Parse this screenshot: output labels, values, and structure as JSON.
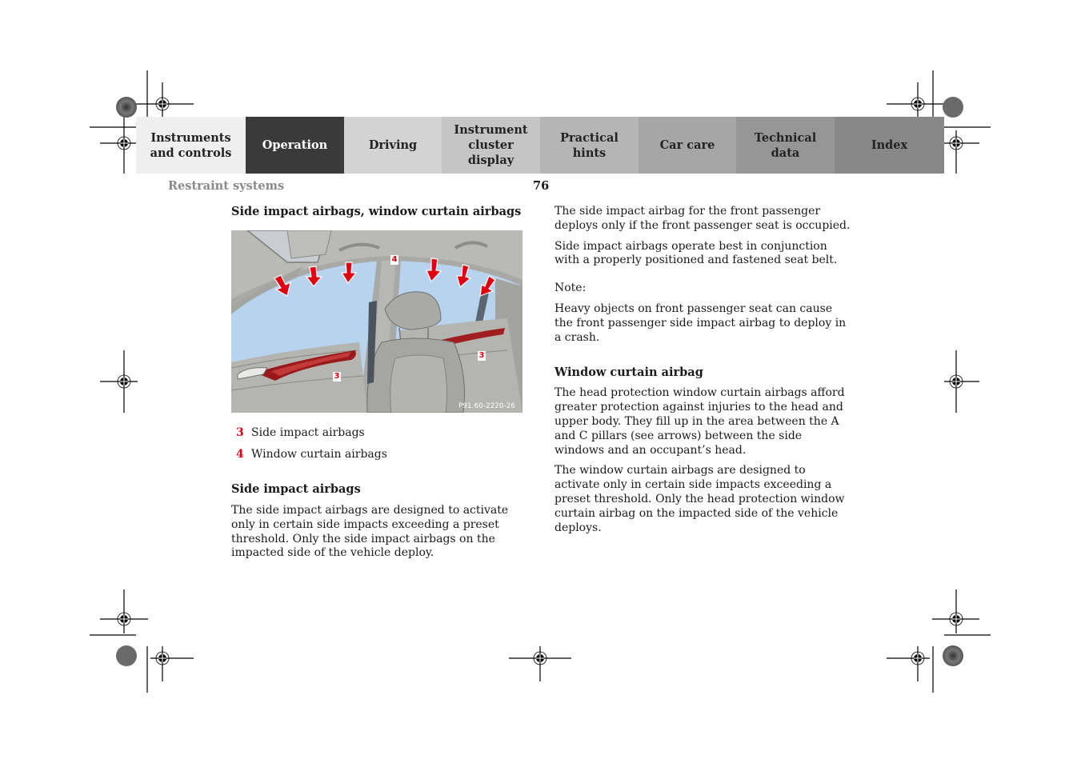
{
  "nav": {
    "tabs": [
      {
        "label": "Instruments\nand controls",
        "color": "#efefef",
        "active": false
      },
      {
        "label": "Operation",
        "color": "#3a3a3a",
        "active": true
      },
      {
        "label": "Driving",
        "color": "#d3d3d3",
        "active": false
      },
      {
        "label": "Instrument\ncluster display",
        "color": "#c5c5c5",
        "active": false
      },
      {
        "label": "Practical hints",
        "color": "#b5b5b5",
        "active": false
      },
      {
        "label": "Car care",
        "color": "#a6a6a6",
        "active": false
      },
      {
        "label": "Technical\ndata",
        "color": "#969696",
        "active": false
      },
      {
        "label": "Index",
        "color": "#888888",
        "active": false
      }
    ]
  },
  "header": {
    "section": "Restraint systems",
    "page_number": "76"
  },
  "left": {
    "heading": "Side impact airbags, window curtain airbags",
    "figure": {
      "code": "P91.60-2220-26",
      "callouts": [
        "4",
        "3",
        "3"
      ]
    },
    "legend": [
      {
        "num": "3",
        "text": "Side impact airbags"
      },
      {
        "num": "4",
        "text": "Window curtain airbags"
      }
    ],
    "subheading": "Side impact airbags",
    "paragraph": "The side impact airbags are designed to activate only in certain side impacts exceeding a preset threshold. Only the side impact airbags on the impacted side of the vehicle deploy."
  },
  "right": {
    "p1": "The side impact airbag for the front passenger deploys only if the front passenger seat is occupied.",
    "p2": "Side impact airbags operate best in conjunction with a properly positioned and fastened seat belt.",
    "note_label": "Note:",
    "note_text": "Heavy objects on front passenger seat can cause the front passenger side impact airbag to deploy in a crash.",
    "heading": "Window curtain airbag",
    "p3": "The head protection window curtain airbags afford greater protection against injuries to the head and upper body. They fill up in the area between the A and C pillars (see arrows) between the side windows and an occupant’s head.",
    "p4": "The window curtain airbags are designed to activate only in certain side impacts exceeding a preset threshold. Only the head protection window curtain airbag on the impacted side of the vehicle deploys."
  },
  "colors": {
    "accent_red": "#e10010",
    "window_blue": "#b8d3ee"
  }
}
